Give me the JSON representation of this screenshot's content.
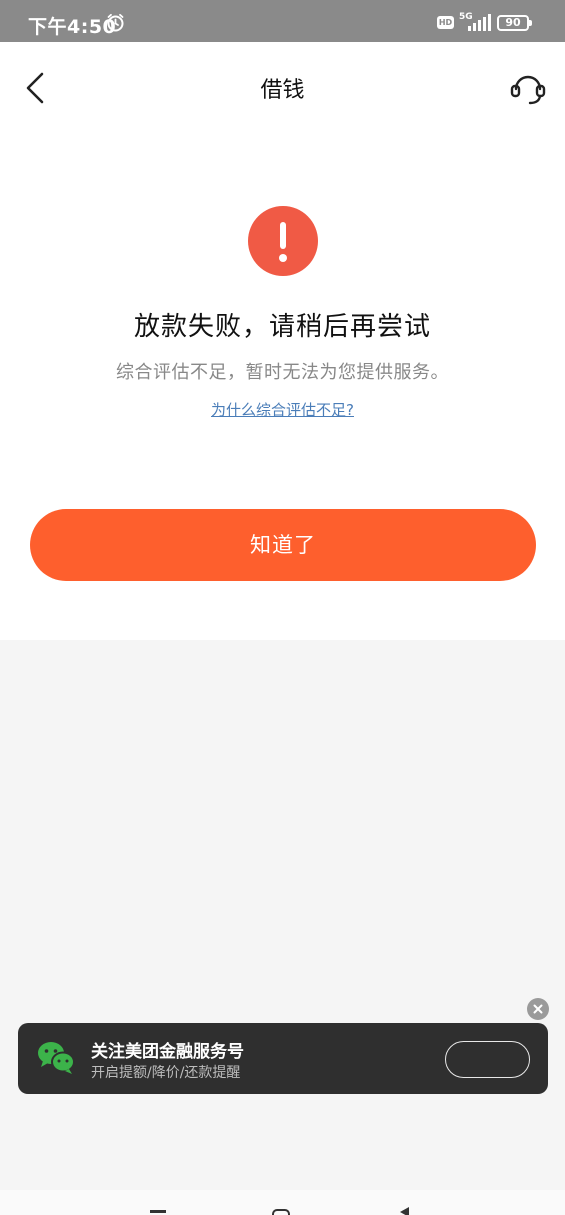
{
  "status_bar": {
    "time": "下午4:50",
    "hd": "HD",
    "network": "5G",
    "battery": "90"
  },
  "header": {
    "title": "借钱"
  },
  "result": {
    "title": "放款失败，请稍后再尝试",
    "description": "综合评估不足，暂时无法为您提供服务。",
    "link": "为什么综合评估不足?"
  },
  "confirm_button": {
    "label": "知道了"
  },
  "follow_banner": {
    "title": "关注美团金融服务号",
    "subtitle": "开启提额/降价/还款提醒"
  },
  "colors": {
    "accent": "#fe5f2d",
    "error": "#f05a45",
    "link": "#4a7db8",
    "wechat": "#3cb34a"
  }
}
